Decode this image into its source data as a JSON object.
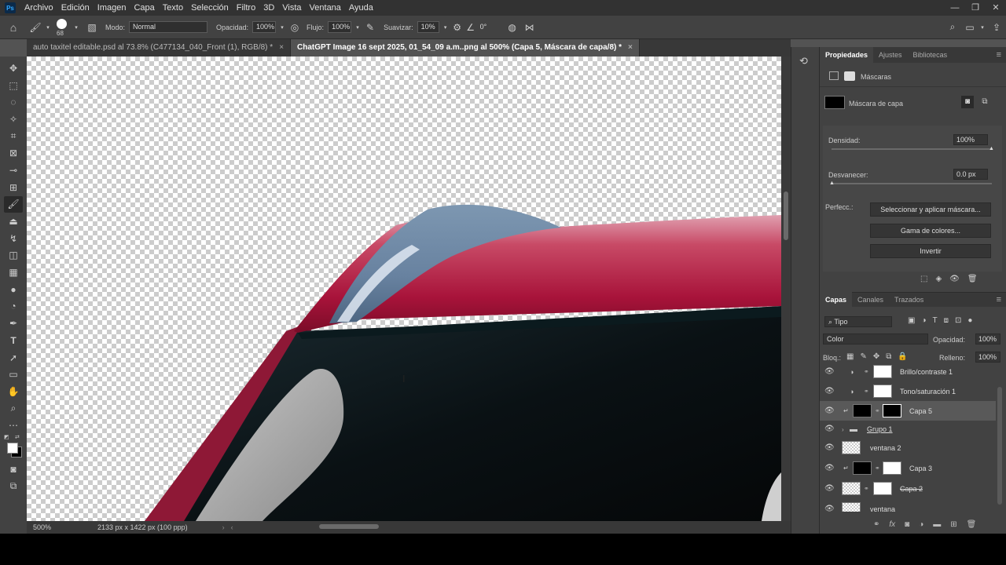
{
  "menu": [
    "Archivo",
    "Edición",
    "Imagen",
    "Capa",
    "Texto",
    "Selección",
    "Filtro",
    "3D",
    "Vista",
    "Ventana",
    "Ayuda"
  ],
  "app_logo": "Ps",
  "options": {
    "brush_size": "68",
    "mode_label": "Modo:",
    "mode_value": "Normal",
    "opacity_label": "Opacidad:",
    "opacity_value": "100%",
    "flow_label": "Flujo:",
    "flow_value": "100%",
    "smooth_label": "Suavizar:",
    "smooth_value": "10%",
    "angle_value": "0°"
  },
  "tabs": [
    {
      "label": "auto taxitel editable.psd al 73.8% (C477134_040_Front (1), RGB/8) *",
      "close": "×"
    },
    {
      "label": "ChatGPT Image 16 sept 2025, 01_54_09 a.m..png al 500% (Capa 5, Máscara de capa/8) *",
      "close": "×"
    }
  ],
  "status": {
    "zoom": "500%",
    "doc_info": "2133 px x 1422 px (100 ppp)"
  },
  "properties": {
    "tabs": [
      "Propiedades",
      "Ajustes",
      "Bibliotecas"
    ],
    "section": "Máscaras",
    "mask_name": "Máscara de capa",
    "density_label": "Densidad:",
    "density_value": "100%",
    "density": 1.0,
    "feather_label": "Desvanecer:",
    "feather_value": "0.0 px",
    "feather": 0.0,
    "refine_label": "Perfecc.:",
    "btn_select_mask": "Seleccionar y aplicar máscara...",
    "btn_color_range": "Gama de colores...",
    "btn_invert": "Invertir"
  },
  "layers_panel": {
    "tabs": [
      "Capas",
      "Canales",
      "Trazados"
    ],
    "filter_kind": "Tipo",
    "blend_mode": "Color",
    "opacity_label": "Opacidad:",
    "opacity_value": "100%",
    "lock_label": "Bloq.:",
    "fill_label": "Relleno:",
    "fill_value": "100%",
    "layers": [
      {
        "name": "Brillo/contraste 1",
        "type": "adjustment"
      },
      {
        "name": "Tono/saturación 1",
        "type": "adjustment"
      },
      {
        "name": "Capa 5",
        "type": "masked",
        "selected": true
      },
      {
        "name": "Grupo 1",
        "type": "group"
      },
      {
        "name": "ventana 2",
        "type": "pixel"
      },
      {
        "name": "Capa 3",
        "type": "masked"
      },
      {
        "name": "Capa 2",
        "type": "masked-pixel"
      },
      {
        "name": "ventana",
        "type": "pixel"
      }
    ]
  },
  "colors": {
    "accent": "#31a8ff",
    "selected_layer": "#595959"
  }
}
